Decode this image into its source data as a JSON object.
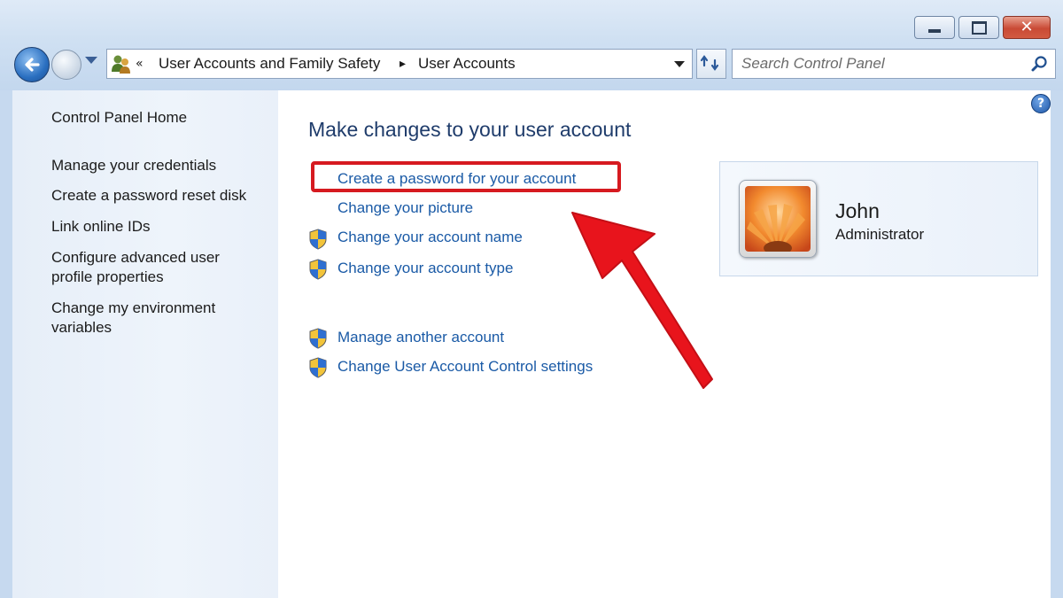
{
  "window": {
    "controls": {
      "minimize": "minimize",
      "maximize": "maximize",
      "close": "close"
    }
  },
  "navigation": {
    "breadcrumb": [
      {
        "label": "User Accounts and Family Safety"
      },
      {
        "label": "User Accounts"
      }
    ],
    "overflow_glyph": "«",
    "separator_glyph": "▸",
    "search_placeholder": "Search Control Panel"
  },
  "sidebar": {
    "items": [
      {
        "label": "Control Panel Home"
      },
      {
        "label": "Manage your credentials"
      },
      {
        "label": "Create a password reset disk"
      },
      {
        "label": "Link online IDs"
      },
      {
        "label": "Configure advanced user profile properties"
      },
      {
        "label": "Change my environment variables"
      }
    ]
  },
  "main": {
    "heading": "Make changes to your user account",
    "links": [
      {
        "label": "Create a password for your account",
        "shield": false
      },
      {
        "label": "Change your picture",
        "shield": false
      },
      {
        "label": "Change your account name",
        "shield": true
      },
      {
        "label": "Change your account type",
        "shield": true
      },
      {
        "label": "Manage another account",
        "shield": true
      },
      {
        "label": "Change User Account Control settings",
        "shield": true
      }
    ],
    "help_glyph": "?"
  },
  "user_card": {
    "name": "John",
    "role": "Administrator"
  },
  "colors": {
    "link": "#1a5aa6",
    "heading": "#1f3c6b",
    "annotation": "#d61a20"
  }
}
